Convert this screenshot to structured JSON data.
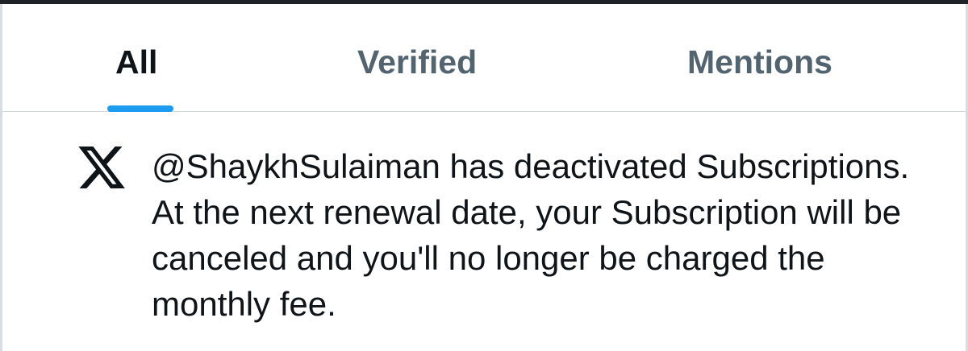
{
  "tabs": [
    {
      "label": "All",
      "active": true
    },
    {
      "label": "Verified",
      "active": false
    },
    {
      "label": "Mentions",
      "active": false
    }
  ],
  "notification": {
    "icon": "x-logo-icon",
    "text": "@ShaykhSulaiman has deactivated Subscriptions. At the next renewal date, your Subscription will be canceled and you'll no longer be charged the monthly fee."
  },
  "colors": {
    "accent": "#1d9bf0",
    "text_primary": "#0f1419",
    "text_secondary": "#536471",
    "divider": "#cfd9de"
  }
}
